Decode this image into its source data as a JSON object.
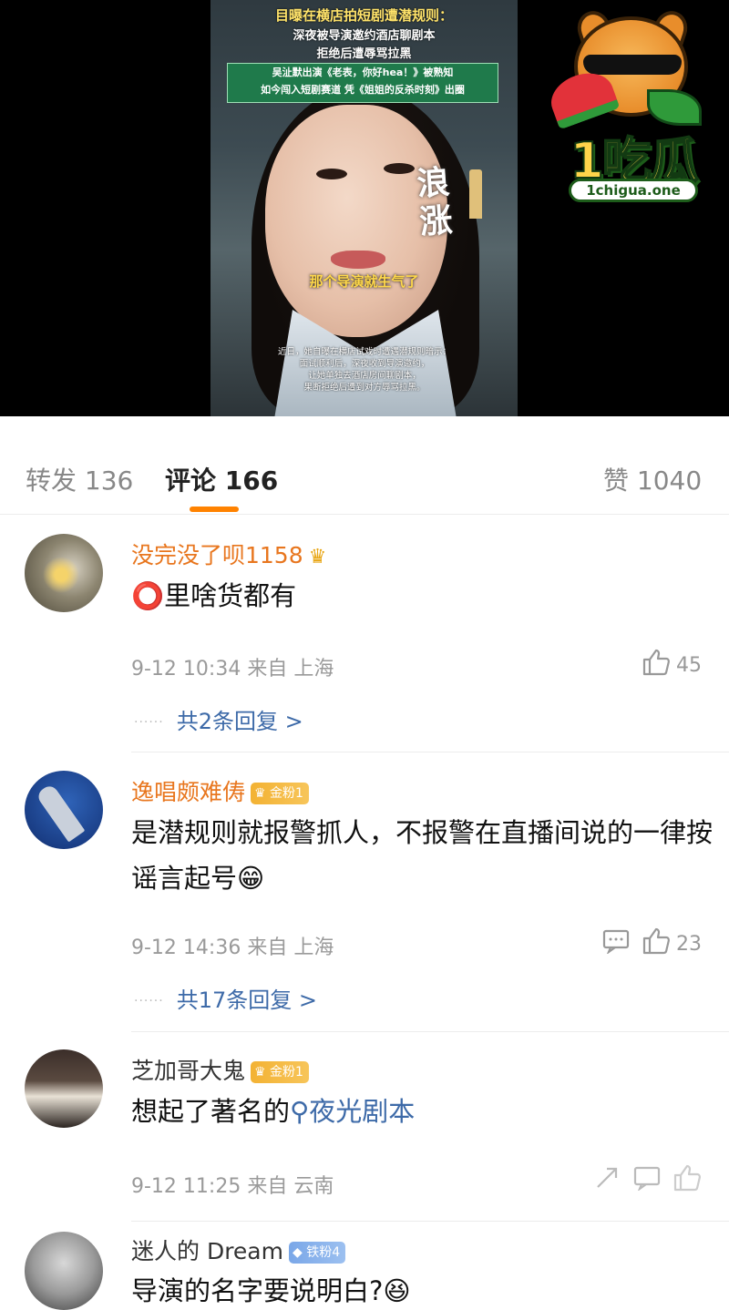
{
  "video": {
    "caption_title": "目曝在横店拍短剧遭潜规则：",
    "caption_line2": "深夜被导演邀约酒店聊剧本",
    "caption_line3": "拒绝后遭辱骂拉黑",
    "green_line1": "吴沚默出演《老表，你好hea！》被熟知",
    "green_line2": "如今闯入短剧赛道 凭《姐姐的反杀时刻》出圈",
    "subtitle": "那个导演就生气了",
    "bottom_line1": "近日，她自曝在横店试戏时遭遇潜规则暗示：",
    "bottom_line2": "面试顺利后，深夜收到导演邀约，",
    "bottom_line3": "让她单独去酒店房间聊剧本，",
    "bottom_line4": "果断拒绝后遭到对方辱骂拉黑。",
    "calligraphy_1": "浪",
    "calligraphy_2": "涨",
    "logo_text": "1吃瓜",
    "logo_url": "1chigua.one"
  },
  "tabs": {
    "repost": "转发 136",
    "comments": "评论 166",
    "likes": "赞 1040",
    "active": "comments",
    "accent_color": "#ff8200"
  },
  "comments": [
    {
      "user": "没完没了呗1158",
      "badge": "",
      "text_emoji": "⭕",
      "text": "里啥货都有",
      "time": "9-12 10:34",
      "location": "来自 上海",
      "likes": "45",
      "replies": "共2条回复 >"
    },
    {
      "user": "逸唱颇难俦",
      "badge": "金粉1",
      "text": "是潜规则就报警抓人，不报警在直播间说的一律按谣言起号",
      "text_emoji": "😁",
      "time": "9-12 14:36",
      "location": "来自 上海",
      "likes": "23",
      "replies": "共17条回复 >"
    },
    {
      "user": "芝加哥大鬼",
      "badge": "金粉1",
      "text": "想起了著名的",
      "link": "夜光剧本",
      "time": "9-12 11:25",
      "location": "来自 云南"
    },
    {
      "user": "迷人的 Dream",
      "badge": "铁粉4",
      "text": "导演的名字要说明白?",
      "text_emoji": "😆"
    }
  ]
}
